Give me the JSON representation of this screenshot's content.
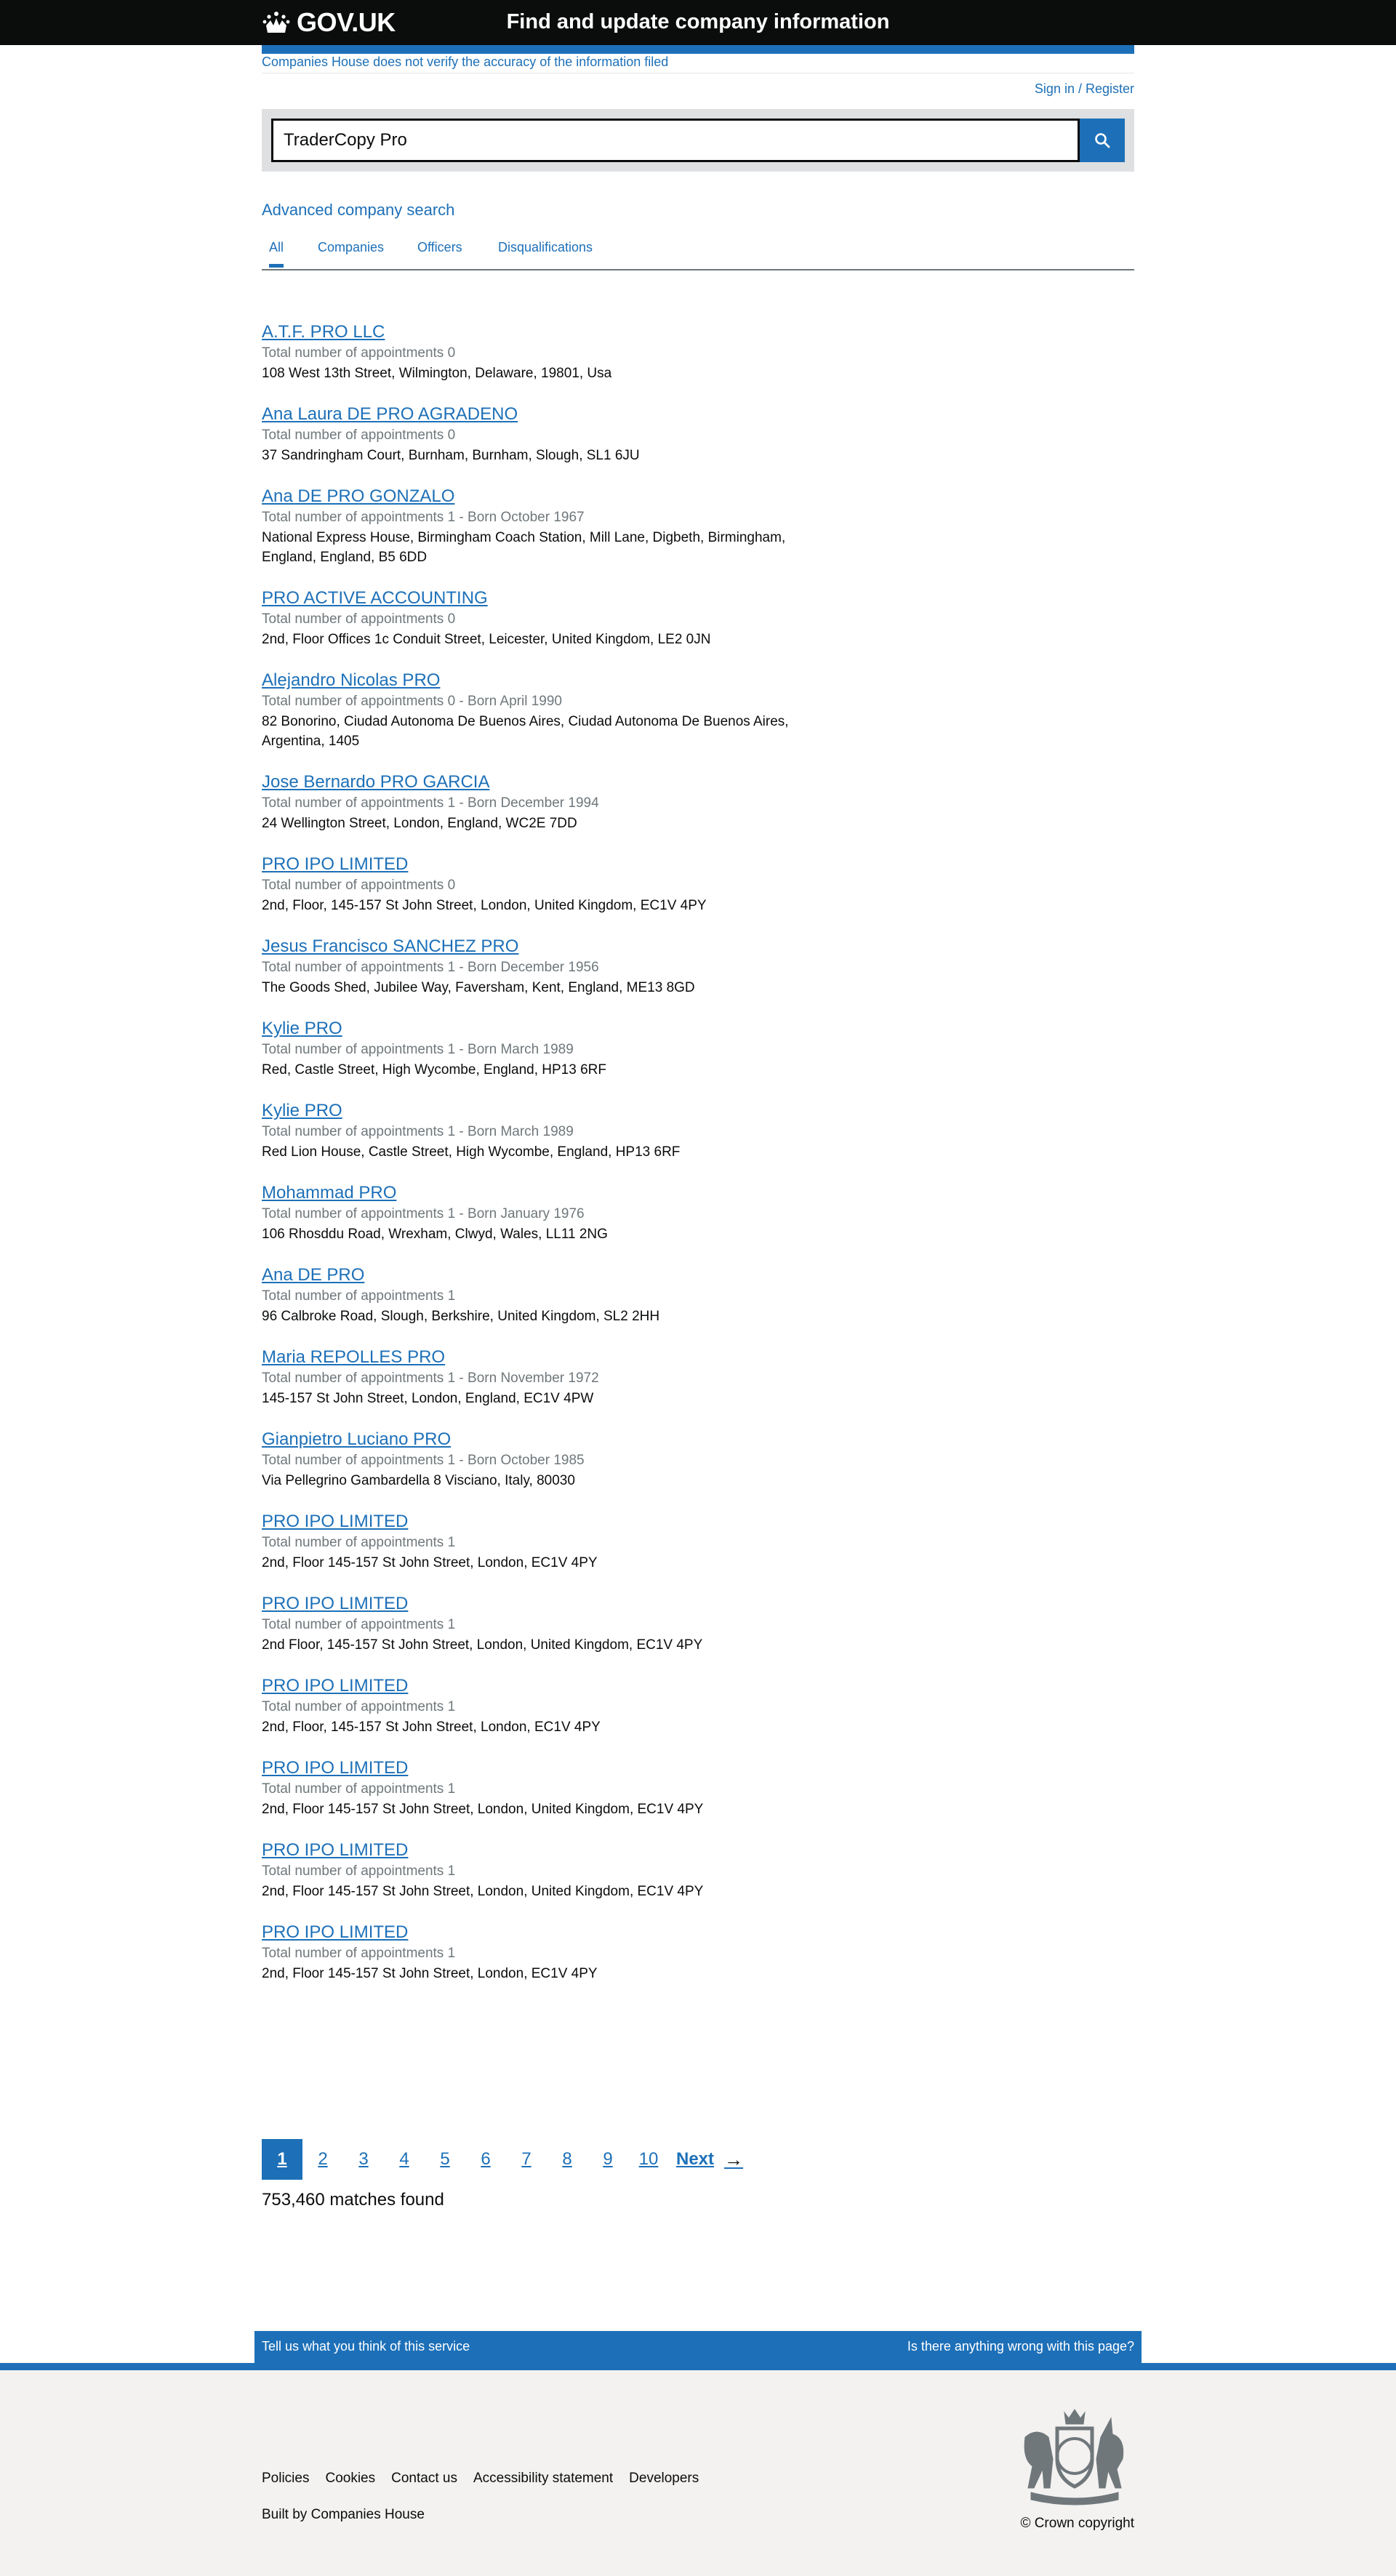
{
  "header": {
    "logo_text": "GOV.UK",
    "service_name": "Find and update company information"
  },
  "disclaimer": "Companies House does not verify the accuracy of the information filed",
  "signin": "Sign in / Register",
  "search": {
    "value": "TraderCopy Pro"
  },
  "advanced_search": "Advanced company search",
  "tabs": [
    {
      "label": "All",
      "active": true
    },
    {
      "label": "Companies",
      "active": false
    },
    {
      "label": "Officers",
      "active": false
    },
    {
      "label": "Disqualifications",
      "active": false
    }
  ],
  "results": [
    {
      "title": "A.T.F. PRO LLC",
      "meta": "Total number of appointments 0",
      "address": "108 West 13th Street, Wilmington, Delaware, 19801, Usa"
    },
    {
      "title": "Ana Laura DE PRO AGRADENO",
      "meta": "Total number of appointments 0",
      "address": "37 Sandringham Court, Burnham, Burnham, Slough, SL1 6JU"
    },
    {
      "title": "Ana DE PRO GONZALO",
      "meta": "Total number of appointments 1 - Born October 1967",
      "address": "National Express House, Birmingham Coach Station, Mill Lane, Digbeth, Birmingham, England, England, B5 6DD"
    },
    {
      "title": "PRO ACTIVE ACCOUNTING",
      "meta": "Total number of appointments 0",
      "address": "2nd, Floor Offices 1c Conduit Street, Leicester, United Kingdom, LE2 0JN"
    },
    {
      "title": "Alejandro Nicolas PRO",
      "meta": "Total number of appointments 0 - Born April 1990",
      "address": "82 Bonorino, Ciudad Autonoma De Buenos Aires, Ciudad Autonoma De Buenos Aires, Argentina, 1405"
    },
    {
      "title": "Jose Bernardo PRO GARCIA",
      "meta": "Total number of appointments 1 - Born December 1994",
      "address": "24 Wellington Street, London, England, WC2E 7DD"
    },
    {
      "title": "PRO IPO LIMITED",
      "meta": "Total number of appointments 0",
      "address": "2nd, Floor, 145-157 St John Street, London, United Kingdom, EC1V 4PY"
    },
    {
      "title": "Jesus Francisco SANCHEZ PRO",
      "meta": "Total number of appointments 1 - Born December 1956",
      "address": "The Goods Shed, Jubilee Way, Faversham, Kent, England, ME13 8GD"
    },
    {
      "title": "Kylie PRO",
      "meta": "Total number of appointments 1 - Born March 1989",
      "address": "Red, Castle Street, High Wycombe, England, HP13 6RF"
    },
    {
      "title": "Kylie PRO",
      "meta": "Total number of appointments 1 - Born March 1989",
      "address": "Red Lion House, Castle Street, High Wycombe, England, HP13 6RF"
    },
    {
      "title": "Mohammad PRO",
      "meta": "Total number of appointments 1 - Born January 1976",
      "address": "106 Rhosddu Road, Wrexham, Clwyd, Wales, LL11 2NG"
    },
    {
      "title": "Ana DE PRO",
      "meta": "Total number of appointments 1",
      "address": "96 Calbroke Road, Slough, Berkshire, United Kingdom, SL2 2HH"
    },
    {
      "title": "Maria REPOLLES PRO",
      "meta": "Total number of appointments 1 - Born November 1972",
      "address": "145-157 St John Street, London, England, EC1V 4PW"
    },
    {
      "title": "Gianpietro Luciano PRO",
      "meta": "Total number of appointments 1 - Born October 1985",
      "address": "Via Pellegrino Gambardella 8 Visciano, Italy, 80030"
    },
    {
      "title": "PRO IPO LIMITED",
      "meta": "Total number of appointments 1",
      "address": "2nd, Floor 145-157 St John Street, London, EC1V 4PY"
    },
    {
      "title": "PRO IPO LIMITED",
      "meta": "Total number of appointments 1",
      "address": "2nd Floor, 145-157 St John Street, London, United Kingdom, EC1V 4PY"
    },
    {
      "title": "PRO IPO LIMITED",
      "meta": "Total number of appointments 1",
      "address": "2nd, Floor, 145-157 St John Street, London, EC1V 4PY"
    },
    {
      "title": "PRO IPO LIMITED",
      "meta": "Total number of appointments 1",
      "address": "2nd, Floor 145-157 St John Street, London, United Kingdom, EC1V 4PY"
    },
    {
      "title": "PRO IPO LIMITED",
      "meta": "Total number of appointments 1",
      "address": "2nd, Floor 145-157 St John Street, London, United Kingdom, EC1V 4PY"
    },
    {
      "title": "PRO IPO LIMITED",
      "meta": "Total number of appointments 1",
      "address": "2nd, Floor 145-157 St John Street, London, EC1V 4PY"
    }
  ],
  "pagination": {
    "pages": [
      "1",
      "2",
      "3",
      "4",
      "5",
      "6",
      "7",
      "8",
      "9",
      "10"
    ],
    "current": "1",
    "next_label": "Next"
  },
  "matches": "753,460 matches found",
  "feedback": {
    "left": "Tell us what you think of this service",
    "right": "Is there anything wrong with this page?"
  },
  "footer": {
    "links": [
      "Policies",
      "Cookies",
      "Contact us",
      "Accessibility statement",
      "Developers"
    ],
    "built_by_prefix": "Built by",
    "built_by_link": "Companies House",
    "copyright": "© Crown copyright"
  },
  "colors": {
    "header_bg": "#0b0c0c",
    "link_blue": "#1d70b8",
    "meta_grey": "#6f777b",
    "footer_bg": "#f3f2f1"
  }
}
